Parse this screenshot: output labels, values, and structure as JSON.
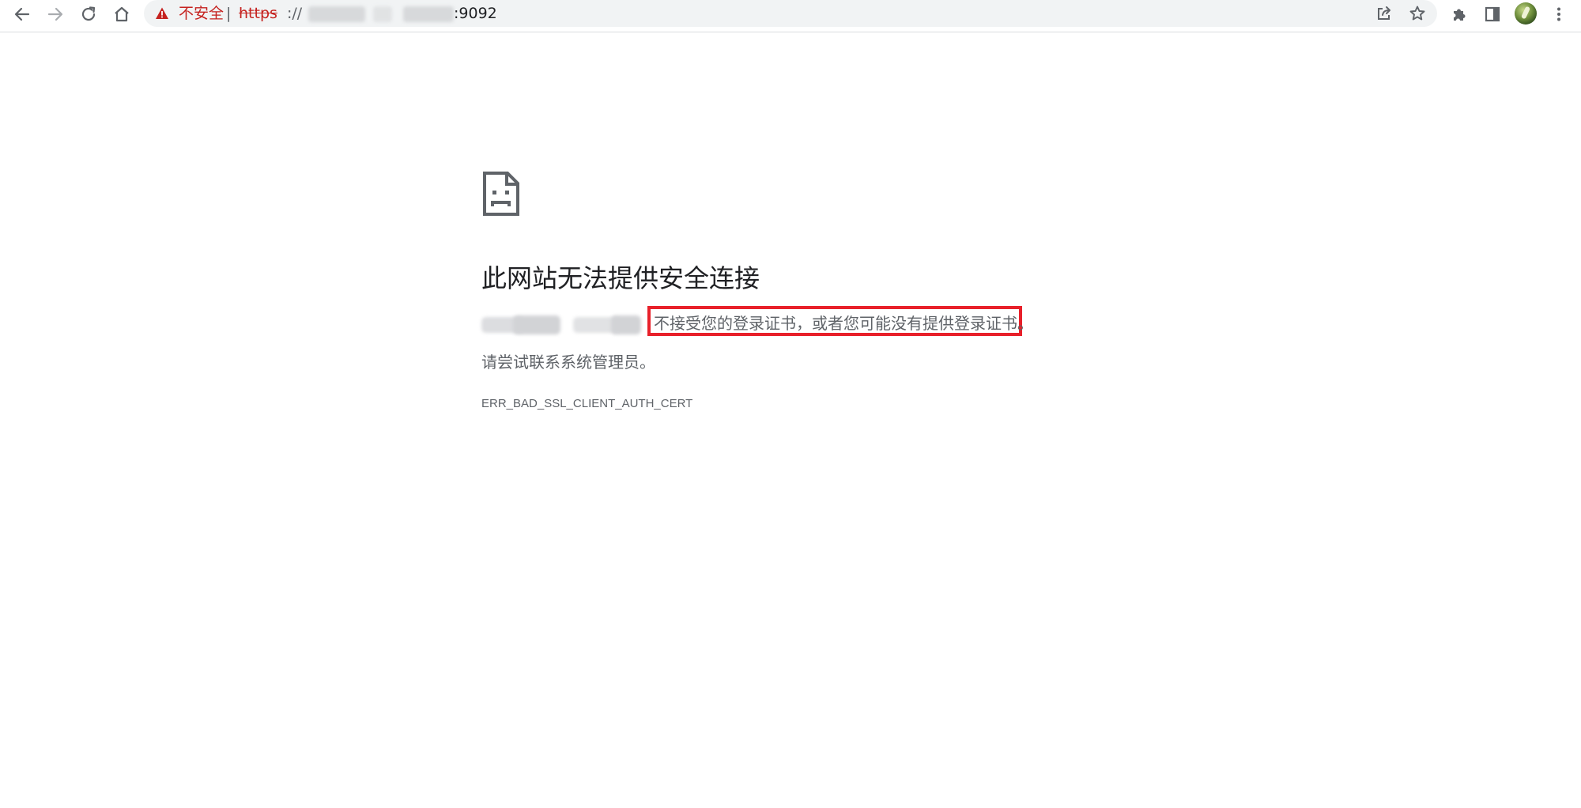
{
  "browser": {
    "security_label": "不安全",
    "separator": "|",
    "url_scheme": "https",
    "url_scheme_separator": "://",
    "url_port": ":9092",
    "icons": [
      "back-icon",
      "forward-icon",
      "reload-icon",
      "home-icon",
      "warning-icon",
      "share-icon",
      "bookmark-star-icon",
      "extensions-icon",
      "side-panel-icon",
      "profile-avatar",
      "menu-icon"
    ]
  },
  "error_page": {
    "icon": "sad-page-icon",
    "heading": "此网站无法提供安全连接",
    "message": "不接受您的登录证书，或者您可能没有提供登录证书。",
    "suggestion": "请尝试联系系统管理员。",
    "error_code": "ERR_BAD_SSL_CLIENT_AUTH_CERT"
  },
  "colors": {
    "warning_red": "#c5221f",
    "highlight_red": "#e8202a",
    "text_primary": "#202124",
    "text_secondary": "#5f6368"
  }
}
